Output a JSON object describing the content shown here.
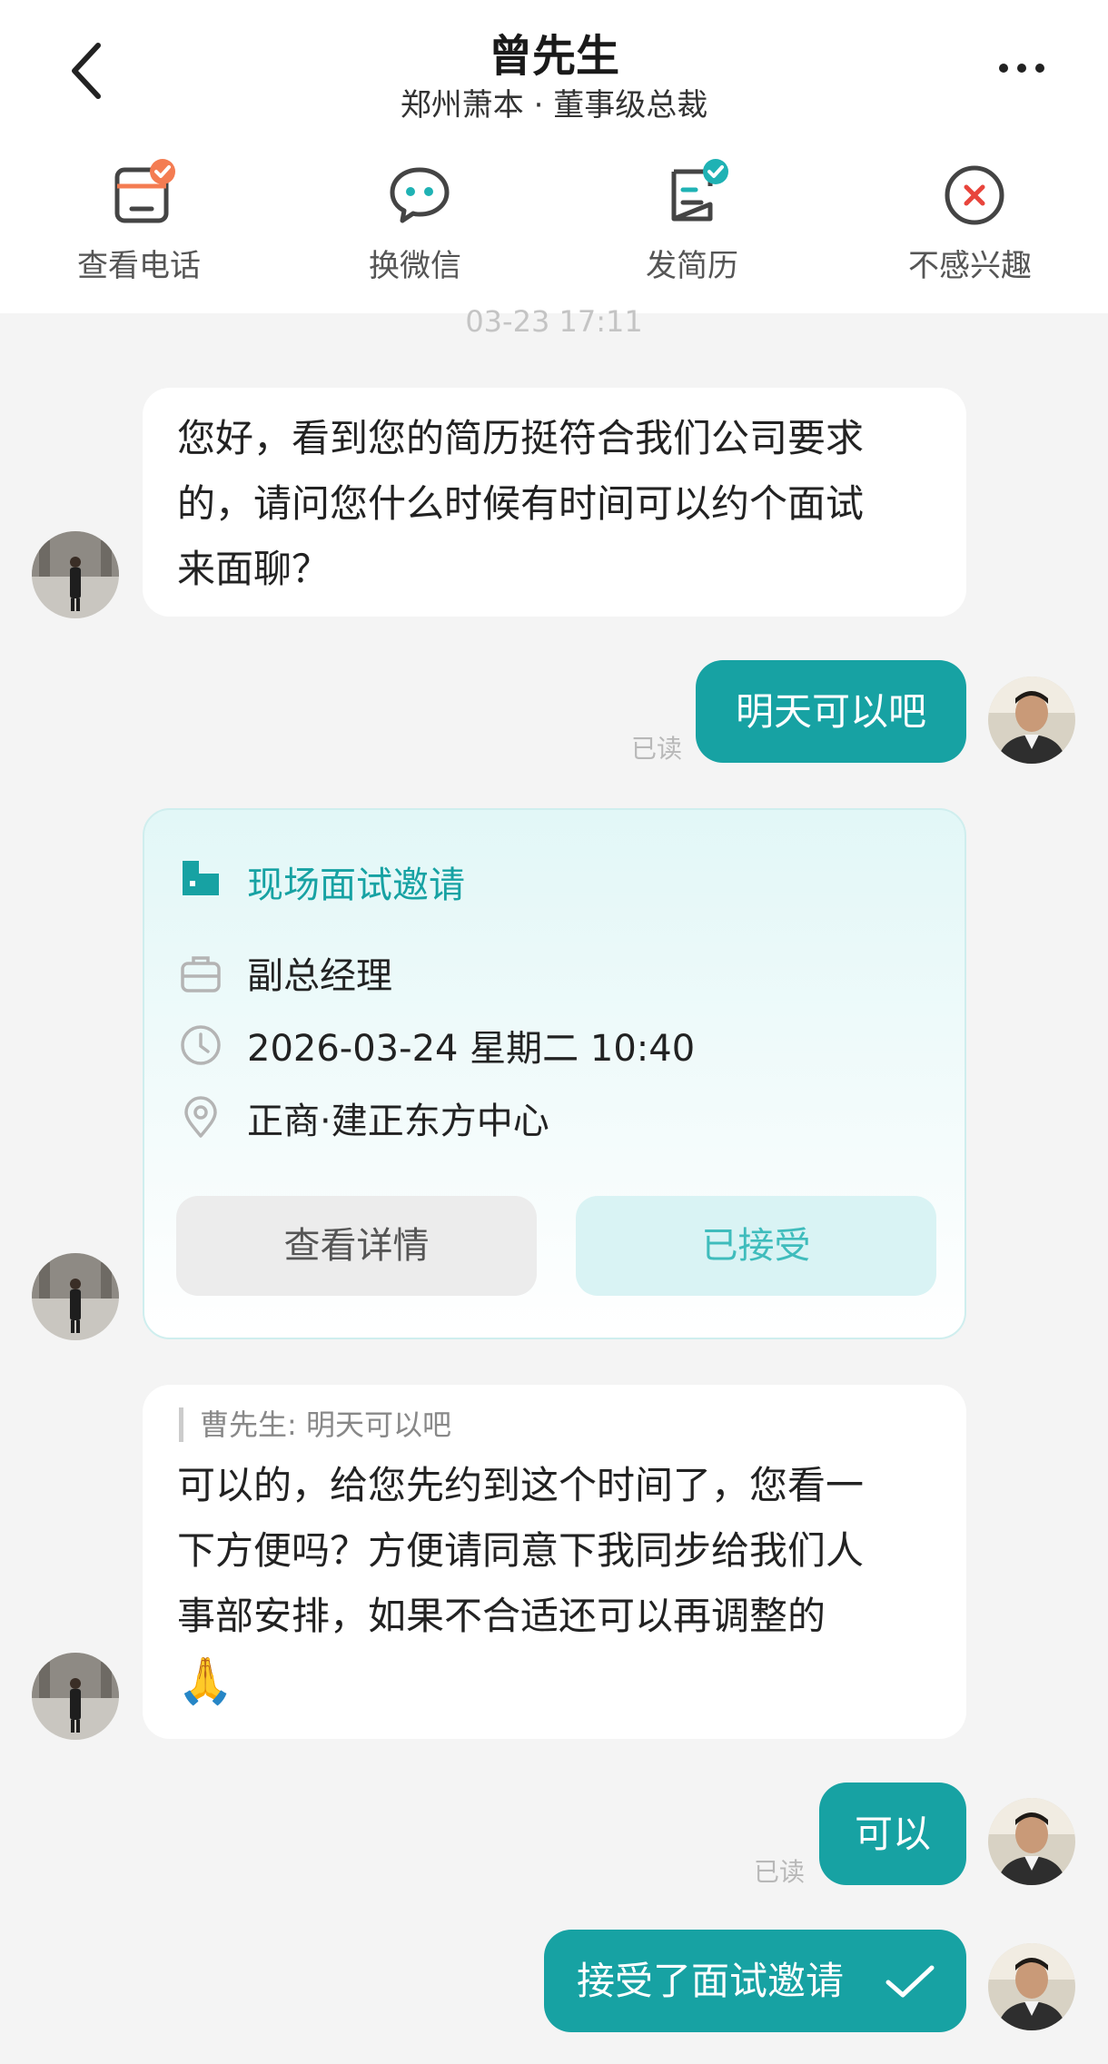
{
  "header": {
    "title": "曾先生",
    "subtitle": "郑州萧本 · 董事级总裁",
    "back_icon": "chevron-left-icon",
    "more_icon": "more-dots-icon"
  },
  "actions": [
    {
      "label": "查看电话",
      "icon": "phone-card-icon"
    },
    {
      "label": "换微信",
      "icon": "wechat-icon"
    },
    {
      "label": "发简历",
      "icon": "resume-icon"
    },
    {
      "label": "不感兴趣",
      "icon": "close-circle-icon"
    }
  ],
  "chat": {
    "timestamp": "03-23 17:11",
    "read_label": "已读",
    "msg1_lines": [
      "您好，看到您的简历挺符合我们公司要求",
      "的，请问您什么时候有时间可以约个面试",
      "来面聊？"
    ],
    "reply1": "明天可以吧",
    "invite": {
      "title": "现场面试邀请",
      "position": "副总经理",
      "datetime": "2026-03-24 星期二 10:40",
      "location": "正商·建正东方中心",
      "detail_button": "查看详情",
      "status_button": "已接受"
    },
    "quote": "曹先生: 明天可以吧",
    "msg2_lines": [
      "可以的，给您先约到这个时间了，您看一",
      "下方便吗？方便请同意下我同步给我们人",
      "事部安排，如果不合适还可以再调整的"
    ],
    "msg2_emoji": "🙏",
    "reply2": "可以",
    "accept_notice": "接受了面试邀请",
    "accept_icon": "check-icon"
  },
  "colors": {
    "accent": "#17a2a3",
    "accent_light": "#d9f3f4",
    "badge_orange": "#f47c52",
    "badge_teal": "#1fb2b4",
    "close_red": "#e8453c"
  }
}
